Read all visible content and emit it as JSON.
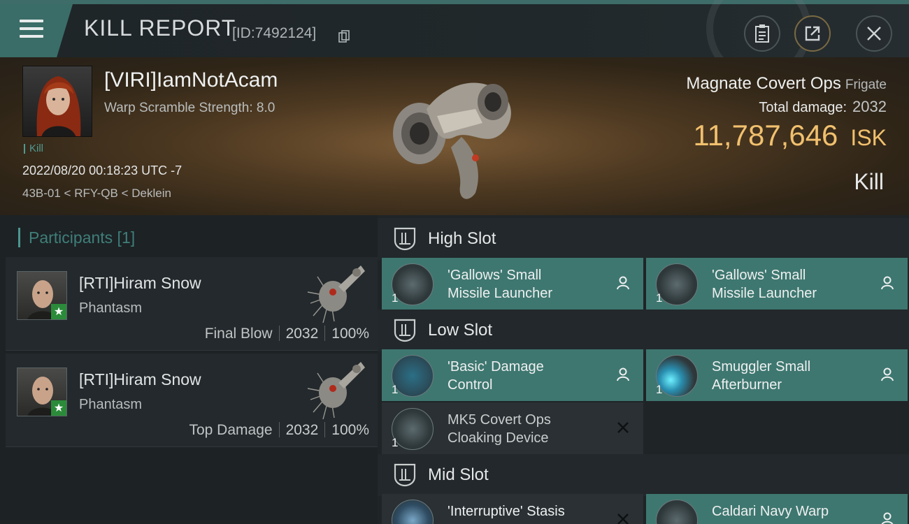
{
  "header": {
    "title": "KILL REPORT",
    "report_id": "[ID:7492124]"
  },
  "victim": {
    "name": "[VIRI]IamNotAcam",
    "warp_scramble": "Warp Scramble Strength: 8.0",
    "tag": "Kill",
    "datetime": "2022/08/20 00:18:23 UTC -7",
    "location": "43B-01 < RFY-QB < Deklein",
    "ship_name": "Magnate Covert Ops",
    "ship_class": "Frigate",
    "total_damage_label": "Total damage:",
    "total_damage": "2032",
    "isk_value": "11,787,646",
    "isk_unit": "ISK",
    "result": "Kill"
  },
  "participants": {
    "title": "Participants [1]",
    "items": [
      {
        "name": "[RTI]Hiram Snow",
        "ship": "Phantasm",
        "label": "Final Blow",
        "damage": "2032",
        "percent": "100%"
      },
      {
        "name": "[RTI]Hiram Snow",
        "ship": "Phantasm",
        "label": "Top Damage",
        "damage": "2032",
        "percent": "100%"
      }
    ]
  },
  "slots": {
    "high": {
      "title": "High Slot",
      "modules": [
        {
          "qty": "1",
          "name": "'Gallows' Small Missile Launcher",
          "status": "dropped"
        },
        {
          "qty": "1",
          "name": "'Gallows' Small Missile Launcher",
          "status": "dropped"
        }
      ]
    },
    "low": {
      "title": "Low Slot",
      "modules": [
        {
          "qty": "1",
          "name": "'Basic' Damage Control",
          "status": "dropped"
        },
        {
          "qty": "1",
          "name": "Smuggler Small Afterburner",
          "status": "dropped"
        },
        {
          "qty": "1",
          "name": "MK5 Covert Ops Cloaking Device",
          "status": "destroyed"
        }
      ]
    },
    "mid": {
      "title": "Mid Slot",
      "modules": [
        {
          "qty": "1",
          "name": "'Interruptive' Stasis",
          "status": "destroyed"
        },
        {
          "qty": "1",
          "name": "Caldari Navy Warp",
          "status": "dropped"
        }
      ]
    }
  },
  "colors": {
    "accent_teal": "#3e7770",
    "isk_gold": "#f1c06e",
    "destroyed_bg": "#2a3033"
  },
  "icons": {
    "menu": "hamburger-menu-icon",
    "copy": "copy-icon",
    "clipboard": "clipboard-icon",
    "share": "share-icon",
    "close": "close-icon",
    "slot": "slot-shield-icon",
    "dropped": "person-icon",
    "destroyed": "x-icon"
  }
}
